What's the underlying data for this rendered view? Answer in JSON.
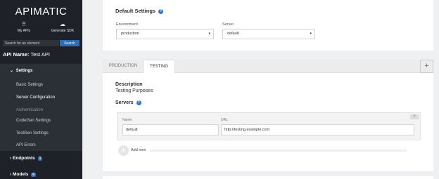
{
  "sidebar": {
    "logo": "APIMATIC",
    "quick_actions": [
      {
        "label": "My APIs",
        "icon": "grid-icon"
      },
      {
        "label": "Generate SDK",
        "icon": "cloud-icon"
      }
    ],
    "search": {
      "placeholder": "Search for an element",
      "button": "Search"
    },
    "api_name_prefix": "API Name:",
    "api_name": "Test API",
    "settings_section": {
      "chevron": "⌄",
      "label": "Settings"
    },
    "settings_items": [
      {
        "label": "Basic Settings"
      },
      {
        "label": "Server Configuration"
      },
      {
        "label": "Authentication"
      },
      {
        "label": "CodeGen Settings"
      },
      {
        "label": "TestGen Settings"
      },
      {
        "label": "API Errors"
      }
    ],
    "endpoints": {
      "chevron": "›",
      "label": "Endpoints",
      "count": "1"
    },
    "models": {
      "chevron": "›",
      "label": "Models",
      "count": "6"
    },
    "accent_color": "#2b6cb5"
  },
  "default_settings": {
    "title": "Default Settings",
    "help": "?",
    "environment": {
      "label": "Environment",
      "value": "production"
    },
    "server": {
      "label": "Server",
      "value": "default"
    }
  },
  "tabs": {
    "items": [
      {
        "label": "PRODUCTION"
      },
      {
        "label": "TESTING"
      }
    ],
    "active": "TESTING",
    "add": "+"
  },
  "environment_detail": {
    "description_label": "Description",
    "description_value": "Testing Purposes",
    "servers_label": "Servers",
    "help": "?",
    "close": "×",
    "server_row": {
      "name_label": "Name",
      "name_value": "default",
      "url_label": "URL",
      "url_value": "http://testing.example.com"
    },
    "add_new": "Add new",
    "add_icon": "+"
  }
}
